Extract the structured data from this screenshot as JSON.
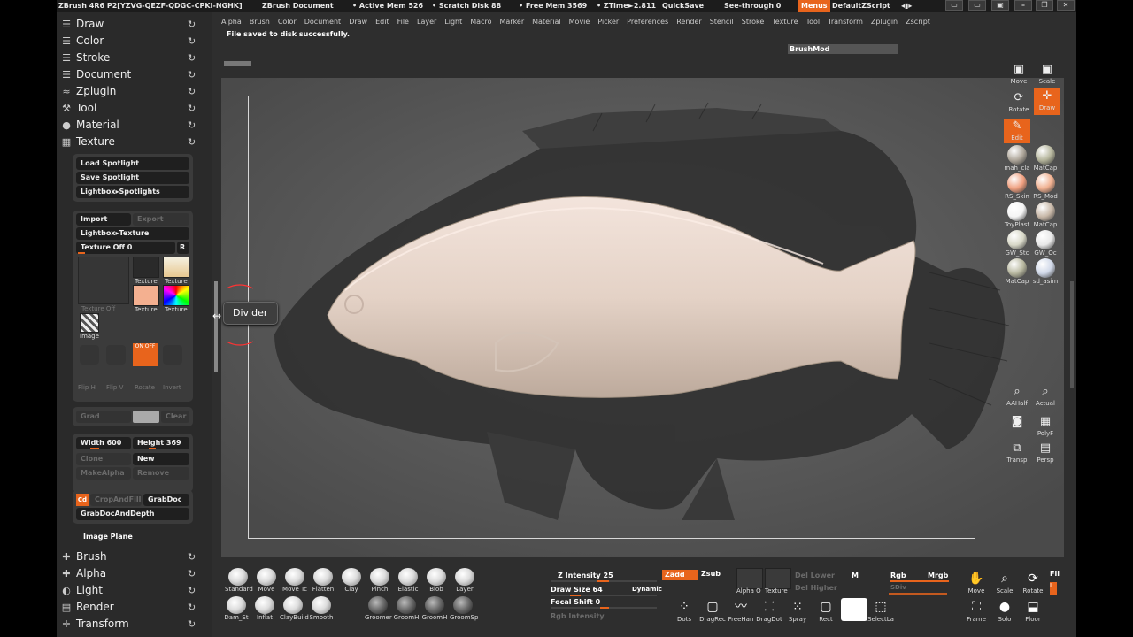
{
  "titlebar": {
    "app": "ZBrush 4R6 P2[YZVG-QEZF-QDGC-CPKI-NGHK]",
    "document": "ZBrush Document",
    "active_mem": "• Active Mem 526",
    "scratch": "• Scratch Disk 88",
    "free_mem": "• Free Mem 3569",
    "ztime": "• ZTime►2.811",
    "quicksave": "QuickSave",
    "see_through": "See-through  0",
    "menus": "Menus",
    "zscript": "DefaultZScript"
  },
  "left_palettes_top": [
    {
      "label": "Draw",
      "icon": "draw-icon",
      "glyph": "☰"
    },
    {
      "label": "Color",
      "icon": "color-icon",
      "glyph": "☰"
    },
    {
      "label": "Stroke",
      "icon": "stroke-icon",
      "glyph": "☰"
    },
    {
      "label": "Document",
      "icon": "document-icon",
      "glyph": "☰"
    },
    {
      "label": "Zplugin",
      "icon": "zplugin-icon",
      "glyph": "≈"
    },
    {
      "label": "Tool",
      "icon": "tool-icon",
      "glyph": "⚒"
    },
    {
      "label": "Material",
      "icon": "material-icon",
      "glyph": "●"
    },
    {
      "label": "Texture",
      "icon": "texture-icon",
      "glyph": "▦"
    }
  ],
  "spotlight": {
    "load": "Load Spotlight",
    "save": "Save Spotlight",
    "lightbox": "Lightbox▸Spotlights"
  },
  "texture_palette": {
    "import": "Import",
    "export": "Export",
    "lightbox": "Lightbox▸Texture",
    "texture_off": "Texture Off",
    "texture_off_value": "0",
    "r": "R",
    "thumb_off_label": "Texture Off",
    "thumb_labels": [
      "Texture",
      "Texture",
      "Texture",
      "Texture"
    ],
    "image_label": "Image",
    "cd_icons": [
      "Flip H",
      "Flip V",
      "Rotate",
      "Invert"
    ],
    "on_off_label": "ON OFF",
    "grad": "Grad",
    "clear": "Clear",
    "width": "Width 600",
    "height": "Height 369",
    "clone": "Clone",
    "new": "New",
    "make_alpha": "MakeAlpha",
    "remove": "Remove",
    "cd": "Cd",
    "crop_and_fill": "CropAndFill",
    "grab_doc": "GrabDoc",
    "grab_doc_depth": "GrabDocAndDepth",
    "image_plane": "Image Plane"
  },
  "left_palettes_bottom": [
    {
      "label": "Brush",
      "icon": "brush-icon",
      "glyph": "✚"
    },
    {
      "label": "Alpha",
      "icon": "alpha-icon",
      "glyph": "✚"
    },
    {
      "label": "Light",
      "icon": "light-icon",
      "glyph": "◐"
    },
    {
      "label": "Render",
      "icon": "render-icon",
      "glyph": "▤"
    },
    {
      "label": "Transform",
      "icon": "transform-icon",
      "glyph": "✛"
    }
  ],
  "menubar": [
    "Alpha",
    "Brush",
    "Color",
    "Document",
    "Draw",
    "Edit",
    "File",
    "Layer",
    "Light",
    "Macro",
    "Marker",
    "Material",
    "Movie",
    "Picker",
    "Preferences",
    "Render",
    "Stencil",
    "Stroke",
    "Texture",
    "Tool",
    "Transform",
    "Zplugin",
    "Zscript"
  ],
  "status_message": "File saved to disk successfully.",
  "brush_mod": "BrushMod",
  "canvas": {
    "tooltip": "Divider"
  },
  "right_shelf": {
    "move": "Move",
    "scale": "Scale",
    "rotate": "Rotate",
    "draw": "Draw",
    "edit": "Edit",
    "materials": [
      {
        "label": "mah_cla",
        "color": "#b0a89c"
      },
      {
        "label": "MatCap",
        "color": "#b5b59c"
      },
      {
        "label": "RS_Skin",
        "color": "#f0a080"
      },
      {
        "label": "RS_Mod",
        "color": "#f0b090"
      },
      {
        "label": "ToyPlast",
        "color": "#f4f4f4"
      },
      {
        "label": "MatCap",
        "color": "#c8b8a8"
      },
      {
        "label": "GW_Stc",
        "color": "#d8d8c8"
      },
      {
        "label": "GW_Oc",
        "color": "#e8e8e8"
      },
      {
        "label": "MatCap",
        "color": "#b8b8a0"
      },
      {
        "label": "sd_asim",
        "color": "#d0d8e8"
      }
    ],
    "aahalf": "AAHalf",
    "actual": "Actual",
    "polyf": "PolyF",
    "transp": "Transp",
    "persp": "Persp"
  },
  "bottom_shelf": {
    "brushes_row1": [
      "Standard",
      "Move",
      "Move Tc",
      "Flatten",
      "Clay",
      "Pinch",
      "Elastic",
      "Blob",
      "Layer"
    ],
    "brushes_row2": [
      "Dam_St",
      "Inflat",
      "ClayBuild",
      "Smooth",
      "Groomer",
      "GroomH",
      "GroomH",
      "GroomSp"
    ],
    "z_intensity": "Z Intensity 25",
    "draw_size": "Draw Size 64",
    "dynamic": "Dynamic",
    "focal_shift": "Focal Shift 0",
    "rgb_intensity": "Rgb Intensity",
    "zadd": "Zadd",
    "zsub": "Zsub",
    "alpha_o": "Alpha O",
    "texture": "Texture",
    "del_lower": "Del Lower",
    "del_higher": "Del Higher",
    "m": "M",
    "rgb": "Rgb",
    "mrgb": "Mrgb",
    "sdiv": "SDiv",
    "strokes": [
      "Dots",
      "DragRec",
      "FreeHan",
      "DragDot",
      "Spray",
      "Rect",
      "",
      "SelectLa"
    ],
    "move": "Move",
    "scale": "Scale",
    "rotate": "Rotate",
    "frame": "Frame",
    "solo": "Solo",
    "floor": "Floor",
    "dynamic2": "Dynamic",
    "fill": "Fil"
  }
}
